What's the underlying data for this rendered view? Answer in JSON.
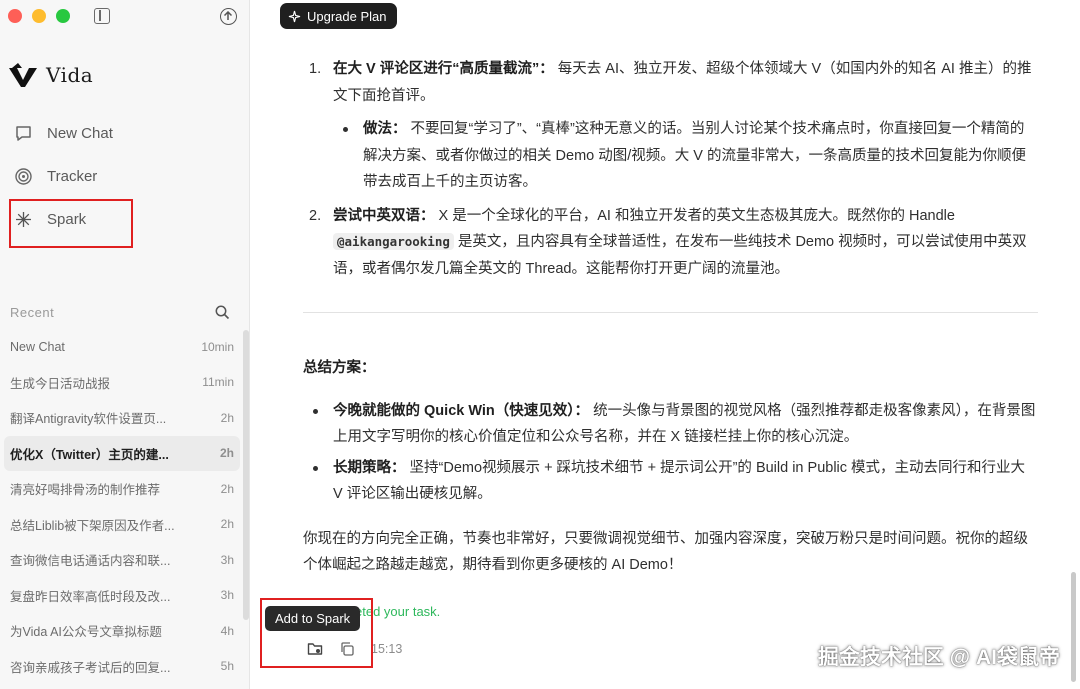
{
  "app": {
    "name": "Vida",
    "upgrade_label": "Upgrade Plan"
  },
  "nav": [
    {
      "label": "New Chat",
      "icon": "chat-bubble-icon"
    },
    {
      "label": "Tracker",
      "icon": "radar-icon"
    },
    {
      "label": "Spark",
      "icon": "spark-icon"
    }
  ],
  "recent": {
    "label": "Recent",
    "items": [
      {
        "title": "New Chat",
        "time": "10min"
      },
      {
        "title": "生成今日活动战报",
        "time": "11min"
      },
      {
        "title": "翻译Antigravity软件设置页...",
        "time": "2h"
      },
      {
        "title": "优化X（Twitter）主页的建...",
        "time": "2h",
        "active": true
      },
      {
        "title": "清亮好喝排骨汤的制作推荐",
        "time": "2h"
      },
      {
        "title": "总结Liblib被下架原因及作者...",
        "time": "2h"
      },
      {
        "title": "查询微信电话通话内容和联...",
        "time": "3h"
      },
      {
        "title": "复盘昨日效率高低时段及改...",
        "time": "3h"
      },
      {
        "title": "为Vida AI公众号文章拟标题",
        "time": "4h"
      },
      {
        "title": "咨询亲戚孩子考试后的回复...",
        "time": "5h"
      }
    ]
  },
  "message": {
    "item1_num": "1.",
    "item1_bold": "在大 V 评论区进行“高质量截流”：",
    "item1_text": " 每天去 AI、独立开发、超级个体领域大 V（如国内外的知名 AI 推主）的推文下面抢首评。",
    "sub1_bold": "做法：",
    "sub1_text": " 不要回复“学习了”、“真棒”这种无意义的话。当别人讨论某个技术痛点时，你直接回复一个精简的解决方案、或者你做过的相关 Demo 动图/视频。大 V 的流量非常大，一条高质量的技术回复能为你顺便带去成百上千的主页访客。",
    "item2_num": "2.",
    "item2_bold": "尝试中英双语：",
    "item2_text_a": " X 是一个全球化的平台，AI 和独立开发者的英文生态极其庞大。既然你的 Handle ",
    "item2_code": "@aikangarooking",
    "item2_text_b": " 是英文，且内容具有全球普适性，在发布一些纯技术 Demo 视频时，可以尝试使用中英双语，或者偶尔发几篇全英文的 Thread。这能帮你打开更广阔的流量池。",
    "summary_title": "总结方案：",
    "s1_bold": "今晚就能做的 Quick Win（快速见效）：",
    "s1_text": " 统一头像与背景图的视觉风格（强烈推荐都走极客像素风），在背景图上用文字写明你的核心价值定位和公众号名称，并在 X 链接栏挂上你的核心沉淀。",
    "s2_bold": "长期策略：",
    "s2_text": " 坚持“Demo视频展示 + 踩坑技术细节 + 提示词公开”的 Build in Public 模式，主动去同行和行业大 V 评论区输出硬核见解。",
    "closing": "你现在的方向完全正确，节奏也非常好，只要微调视觉细节、加强内容深度，突破万粉只是时间问题。祝你的超级个体崛起之路越走越宽，期待看到你更多硬核的 AI Demo！"
  },
  "status_text": "as completed your task.",
  "tooltip": "Add to Spark",
  "timestamp": "15:13",
  "watermark": "掘金技术社区 @ AI袋鼠帝",
  "colors": {
    "highlight": "#e02020",
    "status": "#2eb85c",
    "button_bg": "#1f1f1f"
  }
}
